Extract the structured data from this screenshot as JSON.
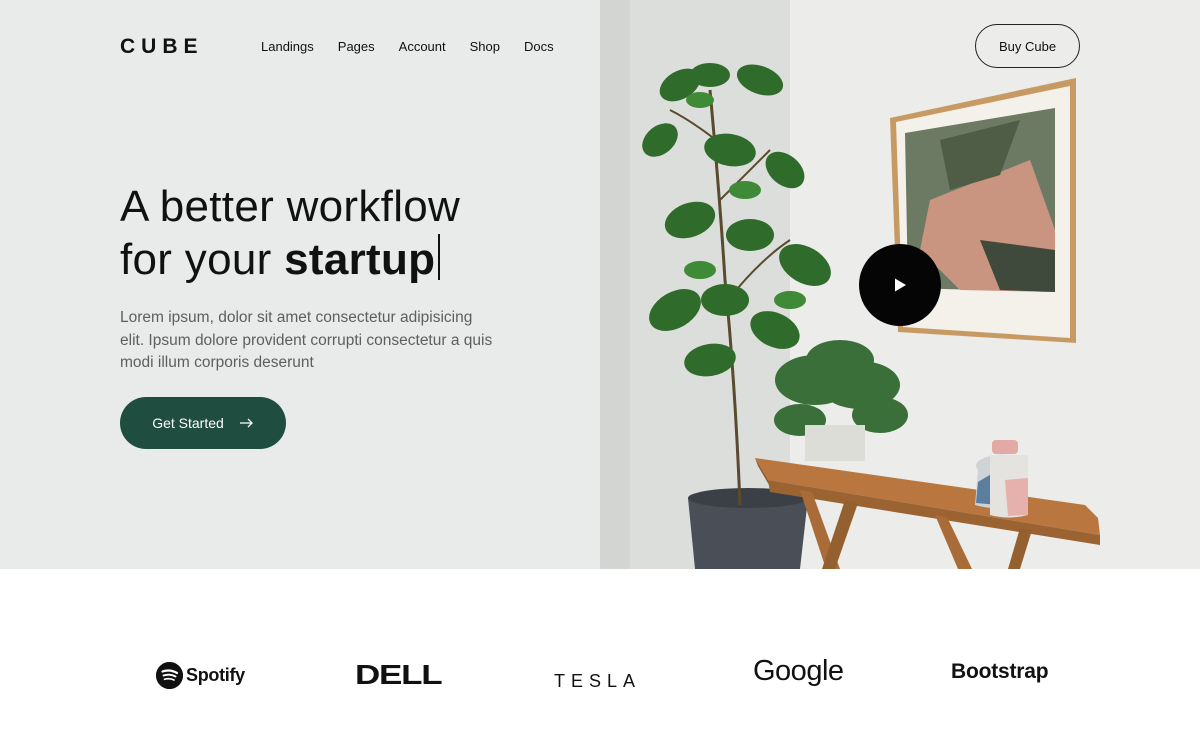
{
  "brand": {
    "logo_text": "CUBE"
  },
  "nav": {
    "items": [
      {
        "label": "Landings"
      },
      {
        "label": "Pages"
      },
      {
        "label": "Account"
      },
      {
        "label": "Shop"
      },
      {
        "label": "Docs"
      }
    ]
  },
  "header": {
    "buy_label": "Buy Cube"
  },
  "hero": {
    "headline_line1": "A better workflow",
    "headline_line2_prefix": "for your ",
    "headline_line2_bold": "startup",
    "lead": "Lorem ipsum, dolor sit amet consectetur adipisicing elit. Ipsum dolore provident corrupti consectetur a quis modi illum corporis deserunt",
    "cta_label": "Get Started",
    "cta_icon": "arrow-right-icon",
    "play_icon": "play-icon"
  },
  "brands": {
    "spotify": "Spotify",
    "dell": "DELL",
    "tesla": "TESLA",
    "google": "Google",
    "bootstrap": "Bootstrap"
  },
  "colors": {
    "hero_bg": "#e9ebea",
    "accent": "#1f4d3f",
    "text": "#111111",
    "muted": "#5b5f5d"
  }
}
